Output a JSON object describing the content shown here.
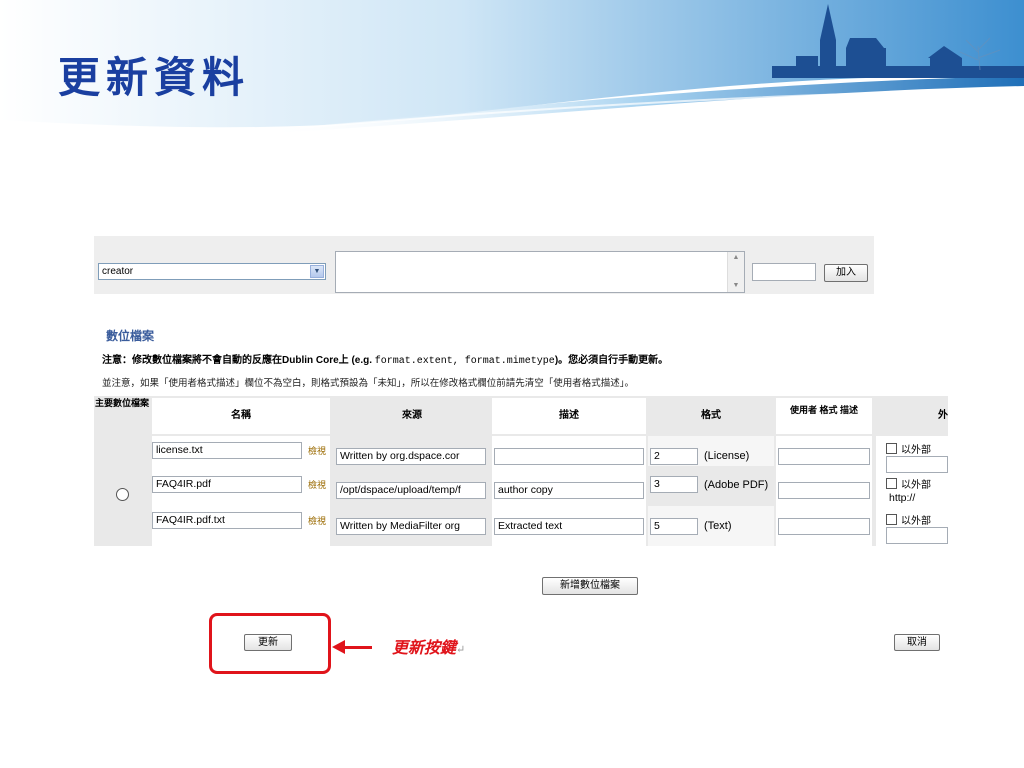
{
  "slide": {
    "title": "更新資料"
  },
  "metadata_row": {
    "field_select": "creator",
    "add_button": "加入"
  },
  "bitstreams": {
    "heading": "數位檔案",
    "note_bold_prefix": "注意：修改數位檔案將不會自動的反應在Dublin Core上 (e.g. ",
    "note_code": "format.extent, format.mimetype",
    "note_bold_suffix": ")。您必須自行手動更新。",
    "note_secondary": "並注意，如果「使用者格式描述」欄位不為空白，則格式預設為「未知」，所以在修改格式欄位前請先清空「使用者格式描述」。",
    "columns": {
      "primary": "主要數位檔案",
      "name": "名稱",
      "source": "來源",
      "description": "描述",
      "format": "格式",
      "user_format": "使用者 格式 描述",
      "external": "外"
    },
    "rows": [
      {
        "name": "license.txt",
        "view_link": "檢視",
        "source": "Written by org.dspace.cor",
        "description": "",
        "format_id": "2",
        "format_label": "(License)",
        "external_label": "以外部",
        "external_url": ""
      },
      {
        "name": "FAQ4IR.pdf",
        "view_link": "檢視",
        "source": "/opt/dspace/upload/temp/f",
        "description": "author copy",
        "format_id": "3",
        "format_label": "(Adobe PDF)",
        "external_label": "以外部",
        "external_url": "http://"
      },
      {
        "name": "FAQ4IR.pdf.txt",
        "view_link": "檢視",
        "source": "Written by MediaFilter org",
        "description": "Extracted text",
        "format_id": "5",
        "format_label": "(Text)",
        "external_label": "以外部",
        "external_url": ""
      }
    ],
    "add_file_button": "新增數位檔案"
  },
  "actions": {
    "update_button": "更新",
    "cancel_button": "取消"
  },
  "callout": {
    "label": "更新按鍵",
    "return_mark": "↵"
  },
  "colors": {
    "title": "#1a3fa0",
    "callout": "#e0141b",
    "header_band": "#5aa5dc"
  }
}
